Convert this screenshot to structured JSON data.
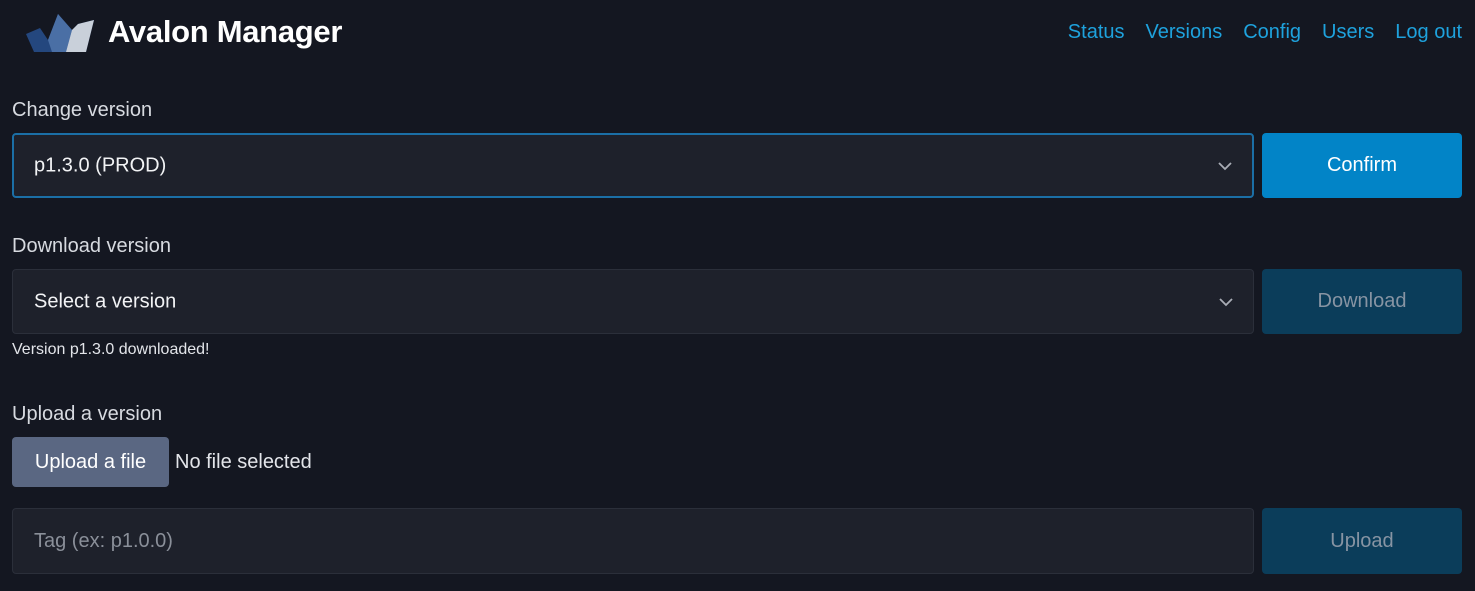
{
  "header": {
    "app_title": "Avalon Manager",
    "nav": [
      {
        "label": "Status"
      },
      {
        "label": "Versions"
      },
      {
        "label": "Config"
      },
      {
        "label": "Users"
      },
      {
        "label": "Log out"
      }
    ],
    "logo_icon": "crown-logo-icon"
  },
  "change_version": {
    "label": "Change version",
    "selected": "p1.3.0 (PROD)",
    "button_label": "Confirm"
  },
  "download_version": {
    "label": "Download version",
    "selected": "Select a version",
    "button_label": "Download",
    "status_message": "Version p1.3.0 downloaded!"
  },
  "upload_version": {
    "label": "Upload a version",
    "file_button_label": "Upload a file",
    "file_status": "No file selected",
    "tag_placeholder": "Tag (ex: p1.0.0)",
    "button_label": "Upload"
  },
  "colors": {
    "background": "#141721",
    "accent_link": "#1ea2dd",
    "primary_button": "#0284c7",
    "disabled_button": "#0b3d5a",
    "file_button": "#5a6782"
  }
}
